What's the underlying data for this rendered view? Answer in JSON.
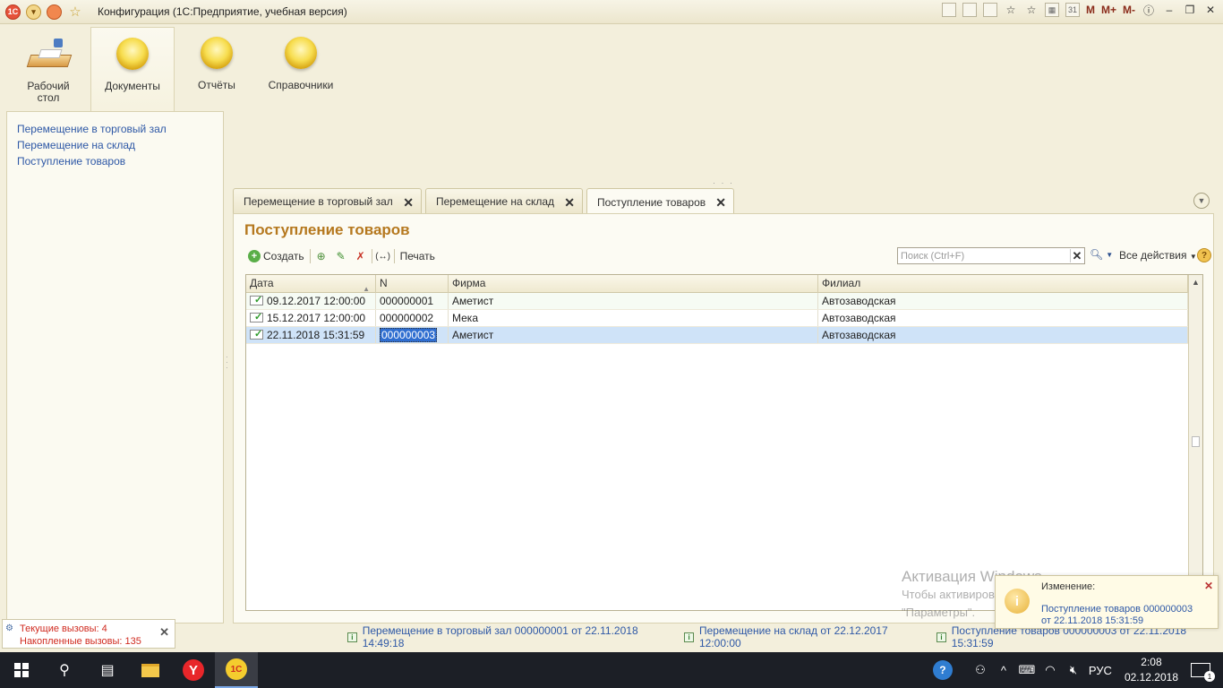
{
  "window": {
    "title": "Конфигурация  (1С:Предприятие, учебная версия)",
    "logo": "1С",
    "toolbar_right": [
      "M",
      "M+",
      "M-"
    ]
  },
  "sections": [
    {
      "label_line1": "Рабочий",
      "label_line2": "стол",
      "icon": "desktop-icon"
    },
    {
      "label_line1": "Документы",
      "label_line2": "",
      "icon": "documents-icon"
    },
    {
      "label_line1": "Отчёты",
      "label_line2": "",
      "icon": "reports-icon"
    },
    {
      "label_line1": "Справочники",
      "label_line2": "",
      "icon": "catalogs-icon"
    }
  ],
  "nav": {
    "items": [
      "Перемещение в торговый зал",
      "Перемещение на склад",
      "Поступление товаров"
    ]
  },
  "tabs": [
    {
      "label": "Перемещение в торговый зал",
      "active": false
    },
    {
      "label": "Перемещение на склад",
      "active": false
    },
    {
      "label": "Поступление товаров",
      "active": true
    }
  ],
  "form": {
    "title": "Поступление товаров",
    "create_label": "Создать",
    "print_label": "Печать",
    "search_placeholder": "Поиск (Ctrl+F)",
    "all_actions_label": "Все действия",
    "help_label": "?"
  },
  "table": {
    "columns": [
      "Дата",
      "N",
      "Фирма",
      "Филиал"
    ],
    "rows": [
      {
        "date": "09.12.2017 12:00:00",
        "number": "000000001",
        "firm": "Аметист",
        "branch": "Автозаводская"
      },
      {
        "date": "15.12.2017 12:00:00",
        "number": "000000002",
        "firm": "Мека",
        "branch": "Автозаводская"
      },
      {
        "date": "22.11.2018 15:31:59",
        "number": "000000003",
        "firm": "Аметист",
        "branch": "Автозаводская"
      }
    ],
    "selected_row": 2
  },
  "calls": {
    "current": "Текущие вызовы: 4",
    "accumulated": "Накопленные вызовы: 135"
  },
  "history": [
    "Перемещение в торговый зал 000000001 от 22.11.2018 14:49:18",
    "Перемещение на склад  от 22.12.2017 12:00:00",
    "Поступление товаров 000000003 от 22.11.2018 15:31:59"
  ],
  "notification": {
    "title": "Изменение:",
    "text": "Поступление товаров 000000003 от 22.11.2018 15:31:59"
  },
  "watermark": {
    "title": "Активация Windows",
    "text": "Чтобы активировать Windows, перейдите в раздел \"Параметры\"."
  },
  "taskbar": {
    "language": "РУС",
    "time": "2:08",
    "date": "02.12.2018",
    "notification_count": "1"
  },
  "colors": {
    "title_accent": "#b5781e",
    "link": "#2e58a6",
    "selected_row": "#cfe3f8",
    "calls_text": "#d02b20"
  }
}
